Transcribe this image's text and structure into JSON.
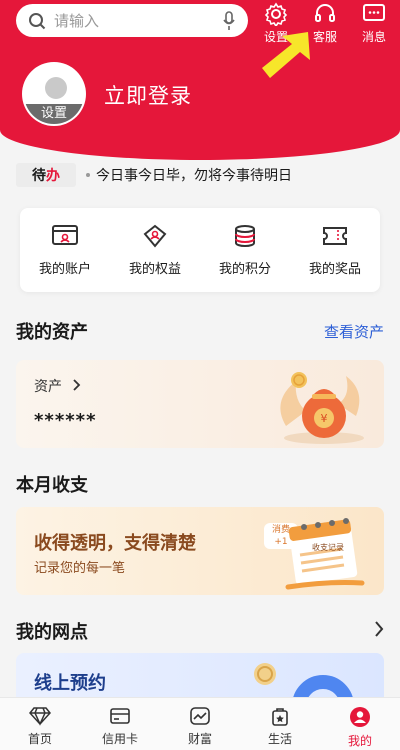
{
  "header": {
    "search": {
      "placeholder": "请输入",
      "icon": "search-icon",
      "voice_icon": "microphone-icon"
    },
    "settings_label": "设置",
    "service_label": "客服",
    "message_label": "消息",
    "accent": "#e5173a"
  },
  "profile": {
    "avatar_caption": "设置",
    "login_text": "立即登录"
  },
  "todo": {
    "badge_1": "待",
    "badge_2": "办",
    "text": "今日事今日毕，勿将今事待明日"
  },
  "quick": [
    {
      "label": "我的账户",
      "icon": "account-card-icon"
    },
    {
      "label": "我的权益",
      "icon": "diamond-tag-icon"
    },
    {
      "label": "我的积分",
      "icon": "coins-stack-icon"
    },
    {
      "label": "我的奖品",
      "icon": "ticket-icon"
    }
  ],
  "assets": {
    "title": "我的资产",
    "link": "查看资产",
    "label": "资产",
    "value": "******"
  },
  "budget": {
    "title": "本月收支",
    "card_title": "收得透明，支得清楚",
    "card_sub": "记录您的每一笔",
    "badge_1": "消费",
    "badge_2": "+1",
    "calendar_label": "收支记录"
  },
  "outlets": {
    "title": "我的网点",
    "card_title": "线上预约"
  },
  "tabbar": [
    {
      "label": "首页",
      "icon": "diamond-icon"
    },
    {
      "label": "信用卡",
      "icon": "credit-card-icon"
    },
    {
      "label": "财富",
      "icon": "trend-chart-icon"
    },
    {
      "label": "生活",
      "icon": "shopping-bag-icon"
    },
    {
      "label": "我的",
      "icon": "user-icon",
      "active": true
    }
  ]
}
